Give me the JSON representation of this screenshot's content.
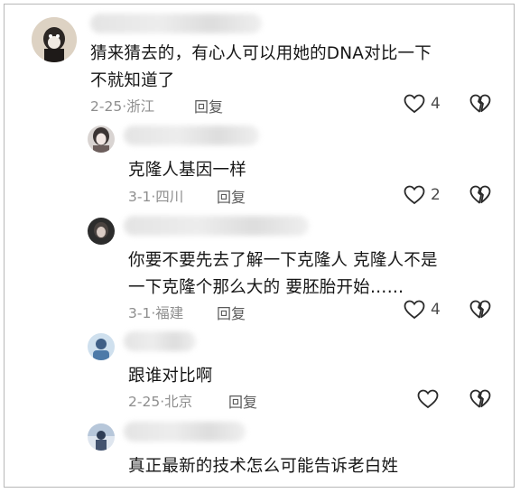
{
  "comments": [
    {
      "text_lines": [
        "猜来猜去的，有心人可以用她的DNA对比一下",
        "不就知道了"
      ],
      "date": "2-25",
      "location": "浙江",
      "reply_label": "回复",
      "like_count": "4"
    },
    {
      "text_lines": [
        "克隆人基因一样"
      ],
      "date": "3-1",
      "location": "四川",
      "reply_label": "回复",
      "like_count": "2"
    },
    {
      "text_lines": [
        "你要不要先去了解一下克隆人  克隆人不是",
        "一下克隆个那么大的  要胚胎开始……"
      ],
      "date": "3-1",
      "location": "福建",
      "reply_label": "回复",
      "like_count": "4"
    },
    {
      "text_lines": [
        "跟谁对比啊"
      ],
      "date": "2-25",
      "location": "北京",
      "reply_label": "回复",
      "like_count": ""
    },
    {
      "text_lines": [
        "真正最新的技术怎么可能告诉老白姓"
      ]
    }
  ],
  "icons": {
    "like": "heart-outline-icon",
    "dislike": "broken-heart-icon"
  },
  "colors": {
    "text": "#161616",
    "meta": "#8e8e8e",
    "icon": "#2a2a2a"
  }
}
